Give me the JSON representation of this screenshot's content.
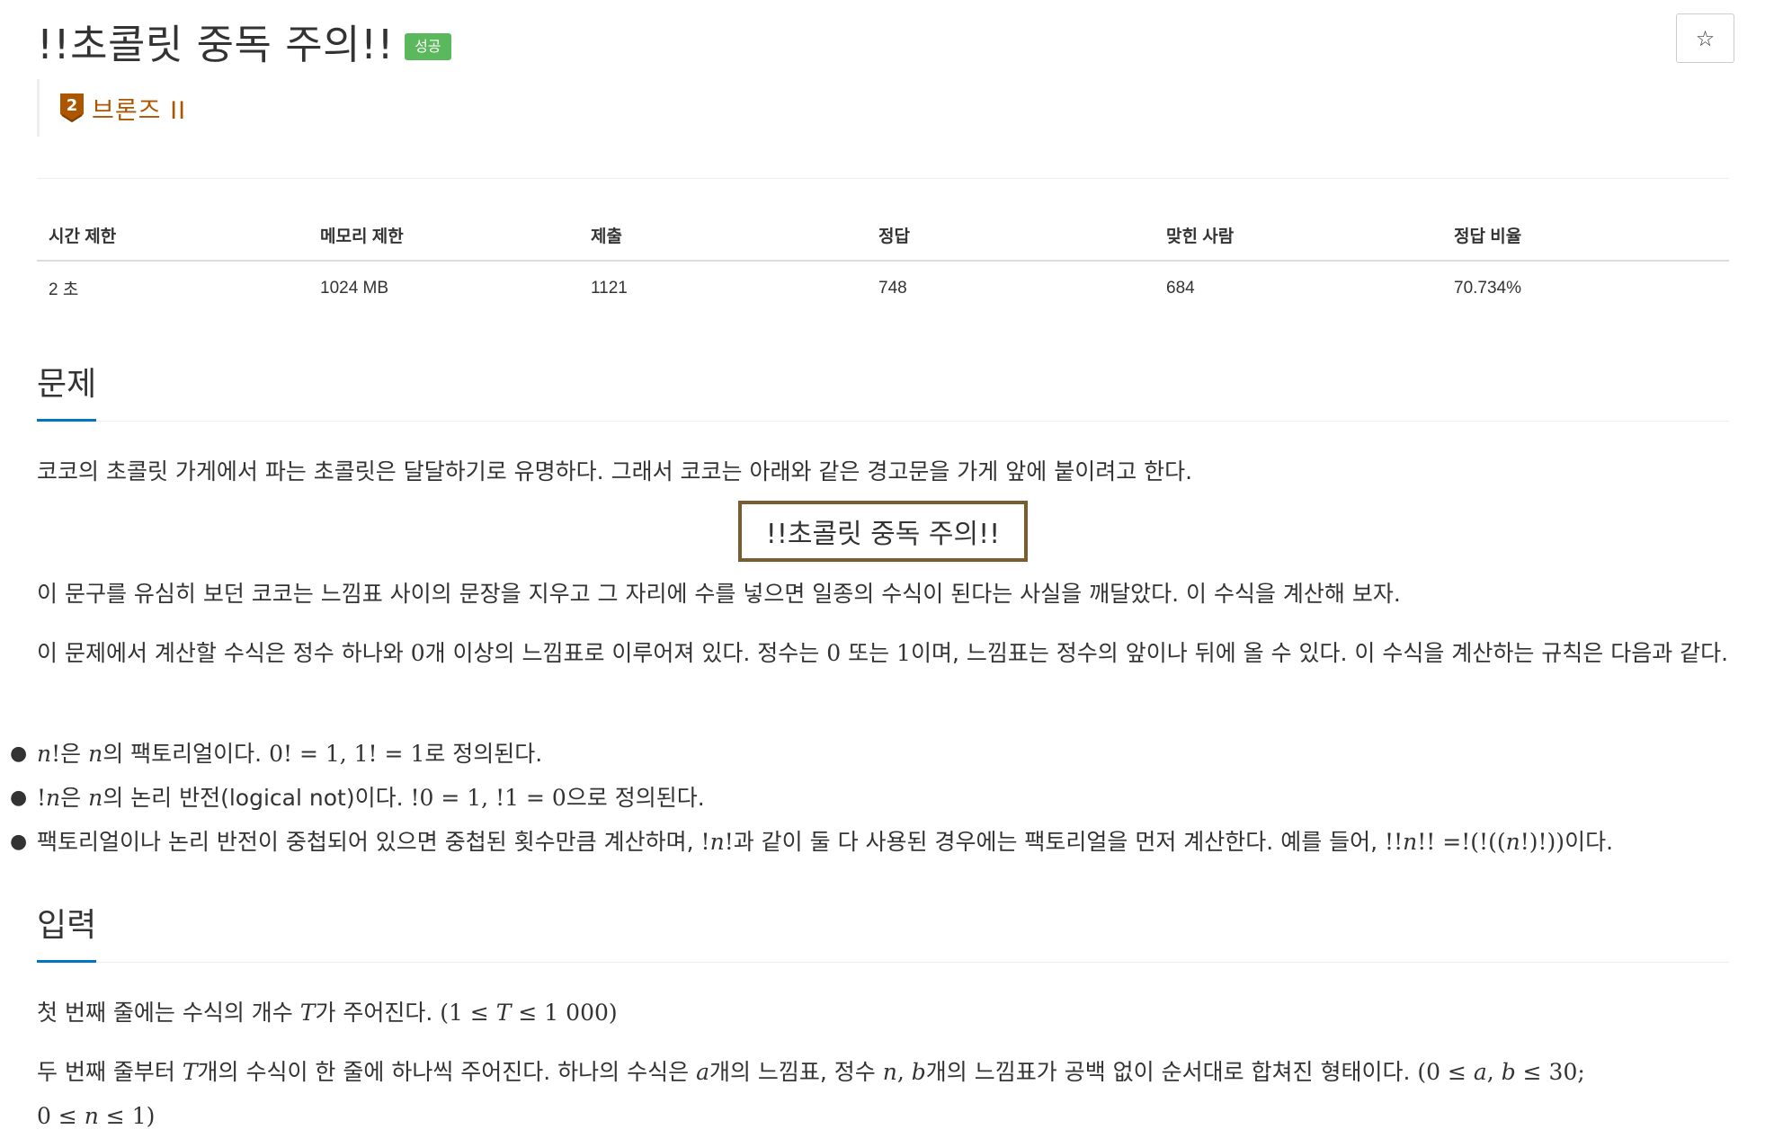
{
  "problem": {
    "title": "!!초콜릿 중독 주의!!",
    "result_badge": "성공",
    "star_icon": "☆",
    "tier": {
      "icon_number": "2",
      "label": "브론즈 II",
      "color": "#ad5600"
    }
  },
  "info_table": {
    "headers": [
      "시간 제한",
      "메모리 제한",
      "제출",
      "정답",
      "맞힌 사람",
      "정답 비율"
    ],
    "values": [
      "2 초",
      "1024 MB",
      "1121",
      "748",
      "684",
      "70.734%"
    ]
  },
  "sections": {
    "problem_heading": "문제",
    "input_heading": "입력"
  },
  "statement": {
    "intro": "코코의 초콜릿 가게에서 파는 초콜릿은 달달하기로 유명하다. 그래서 코코는 아래와 같은 경고문을 가게 앞에 붙이려고 한다.",
    "warning": "!!초콜릿 중독 주의!!",
    "para2": "이 문구를 유심히 보던 코코는 느낌표 사이의 문장을 지우고 그 자리에 수를 넣으면 일종의 수식이 된다는 사실을 깨달았다. 이 수식을 계산해 보자.",
    "para3_a": "이 문제에서 계산할 수식은 정수 하나와 ",
    "para3_m1": "0",
    "para3_b": "개 이상의 느낌표로 이루어져 있다. 정수는 ",
    "para3_m2": "0",
    "para3_c": " 또는 ",
    "para3_m3": "1",
    "para3_d": "이며, 느낌표는 정수의 앞이나 뒤에 올 수 있다. 이 수식을 계산하는 규칙은 다음과 같다.",
    "rule1_a": "n",
    "rule1_b": "!",
    "rule1_c": "은 ",
    "rule1_d": "n",
    "rule1_e": "의 팩토리얼이다. ",
    "rule1_f": "0! = 1, 1! = 1",
    "rule1_g": "로 정의된다.",
    "rule2_a": "!",
    "rule2_b": "n",
    "rule2_c": "은 ",
    "rule2_d": "n",
    "rule2_e": "의 논리 반전(logical not)이다. ",
    "rule2_f": "!0 = 1, !1 = 0",
    "rule2_g": "으로 정의된다.",
    "rule3_a": "팩토리얼이나 논리 반전이 중첩되어 있으면 중첩된 횟수만큼 계산하며, ",
    "rule3_b": "!",
    "rule3_c": "n",
    "rule3_d": "!",
    "rule3_e": "과 같이 둘 다 사용된 경우에는 팩토리얼을 먼저 계산한다. 예를 들어, ",
    "rule3_f": "!!",
    "rule3_g": "n",
    "rule3_h": "!! =!(!((",
    "rule3_i": "n",
    "rule3_j": "!)!))",
    "rule3_k": "이다."
  },
  "input_section": {
    "line1_a": "첫 번째 줄에는 수식의 개수 ",
    "line1_b": "T",
    "line1_c": "가 주어진다. ",
    "line1_d": "(1 ≤ ",
    "line1_e": "T",
    "line1_f": " ≤ 1 000)",
    "line2_a": "두 번째 줄부터 ",
    "line2_b": "T",
    "line2_c": "개의 수식이 한 줄에 하나씩 주어진다. 하나의 수식은 ",
    "line2_d": "a",
    "line2_e": "개의 느낌표, 정수 ",
    "line2_f": "n",
    "line2_g": ", ",
    "line2_h": "b",
    "line2_i": "개의 느낌표가 공백 없이 순서대로 합쳐진 형태이다. ",
    "line2_j": "(0 ≤ ",
    "line2_k": "a",
    "line2_l": ", ",
    "line2_m": "b",
    "line2_n": " ≤ 30;",
    "line3_a": "0 ≤ ",
    "line3_b": "n",
    "line3_c": " ≤ 1)"
  },
  "colors": {
    "success_badge": "#5cb85c",
    "tier_bronze": "#ad5600",
    "section_underline": "#0076c0",
    "warning_border": "#7a5c2e"
  }
}
